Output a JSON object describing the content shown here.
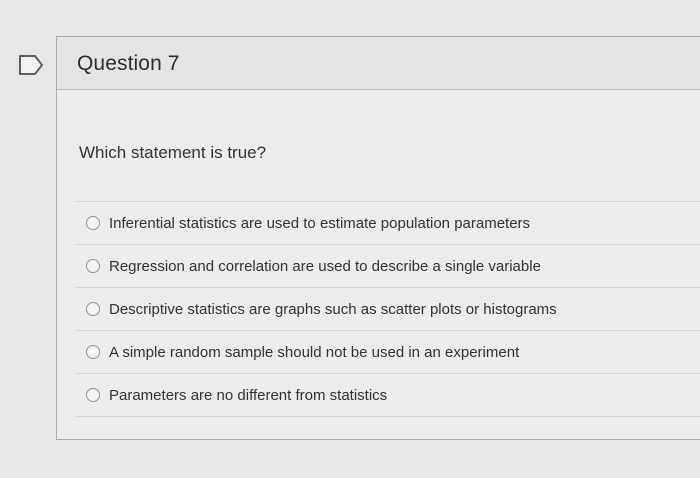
{
  "question": {
    "title": "Question 7",
    "prompt": "Which statement is true?",
    "flag_icon": "bookmark-flag-icon",
    "options": [
      {
        "label": "Inferential statistics are used to estimate population parameters",
        "selected": false
      },
      {
        "label": "Regression and correlation are used to describe a single variable",
        "selected": false
      },
      {
        "label": "Descriptive statistics are graphs such as scatter plots or histograms",
        "selected": false
      },
      {
        "label": "A simple random sample should not be used in an experiment",
        "selected": false
      },
      {
        "label": "Parameters are no different from statistics",
        "selected": false
      }
    ]
  },
  "colors": {
    "background": "#e7e8e6",
    "border": "#a9abab",
    "text": "#2b2d31"
  }
}
